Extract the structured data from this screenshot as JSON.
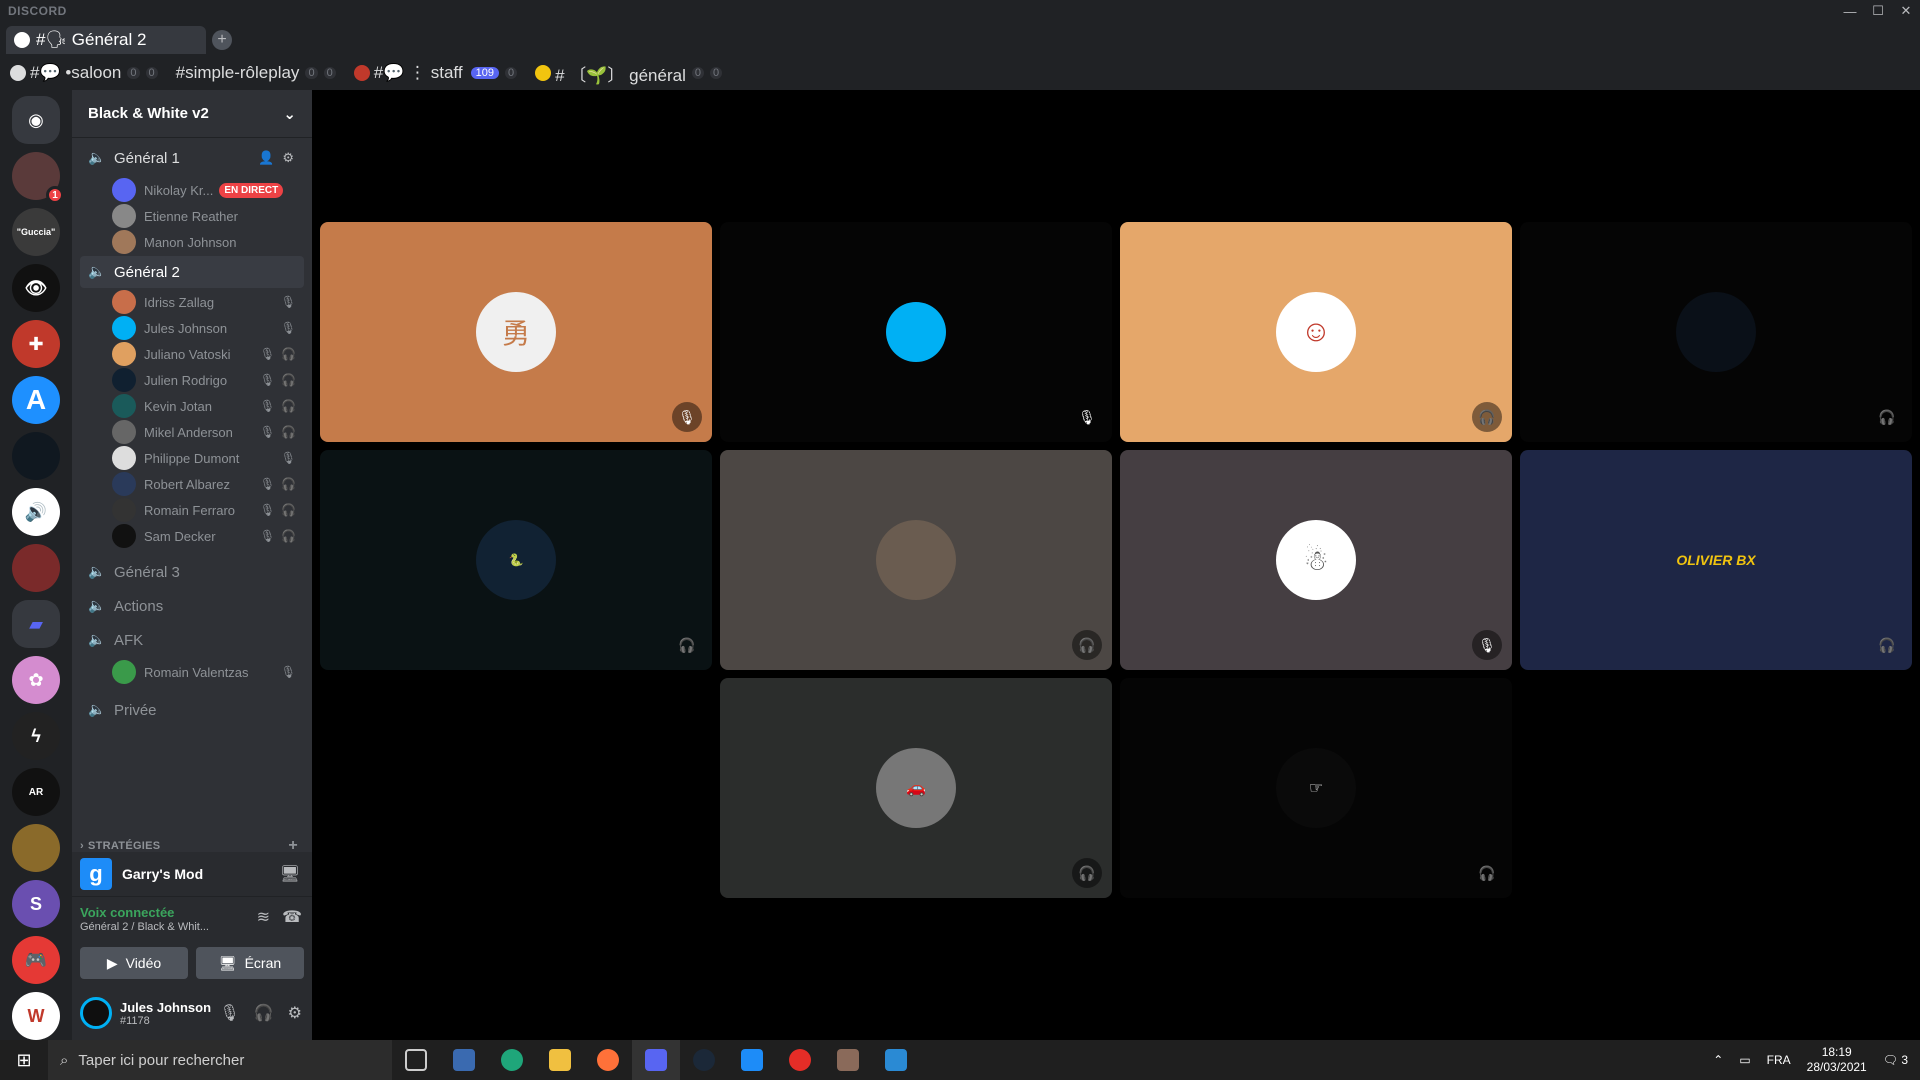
{
  "app": {
    "brand": "DISCORD"
  },
  "tab": {
    "title": "#🗣 Général 2"
  },
  "bookmarks": [
    {
      "label": "#💬 •saloon",
      "c1": "0",
      "c2": "0"
    },
    {
      "label": "#simple-rôleplay",
      "c1": "0",
      "c2": "0"
    },
    {
      "label": "#💬 ⋮ staff",
      "badge": "109",
      "c2": "0"
    },
    {
      "label": "# 〔🌱〕 général",
      "c1": "0",
      "c2": "0"
    }
  ],
  "guild": {
    "name": "Black & White v2"
  },
  "channels": {
    "general1": "Général 1",
    "general2": "Général 2",
    "general3": "Général 3",
    "actions": "Actions",
    "afk": "AFK",
    "privee": "Privée"
  },
  "members_g1": [
    {
      "name": "Nikolay Kr...",
      "live": "EN DIRECT"
    },
    {
      "name": "Etienne Reather"
    },
    {
      "name": "Manon Johnson"
    }
  ],
  "members_g2": [
    "Idriss Zallag",
    "Jules Johnson",
    "Juliano Vatoski",
    "Julien Rodrigo",
    "Kevin Jotan",
    "Mikel Anderson",
    "Philippe Dumont",
    "Robert Albarez",
    "Romain Ferraro",
    "Sam Decker"
  ],
  "members_afk": [
    "Romain Valentzas"
  ],
  "category": {
    "label": "STRATÉGIES"
  },
  "activity": {
    "name": "Garry's Mod"
  },
  "voice": {
    "status": "Voix connectée",
    "sub": "Général 2 / Black & Whit...",
    "video": "Vidéo",
    "screen": "Écran"
  },
  "user": {
    "name": "Jules Johnson",
    "tag": "#1178"
  },
  "tiles": [
    {
      "label": "OLIVIER BX"
    }
  ],
  "taskbar": {
    "search": "Taper ici pour rechercher",
    "lang": "FRA",
    "time": "18:19",
    "date": "28/03/2021",
    "notif": "3"
  }
}
